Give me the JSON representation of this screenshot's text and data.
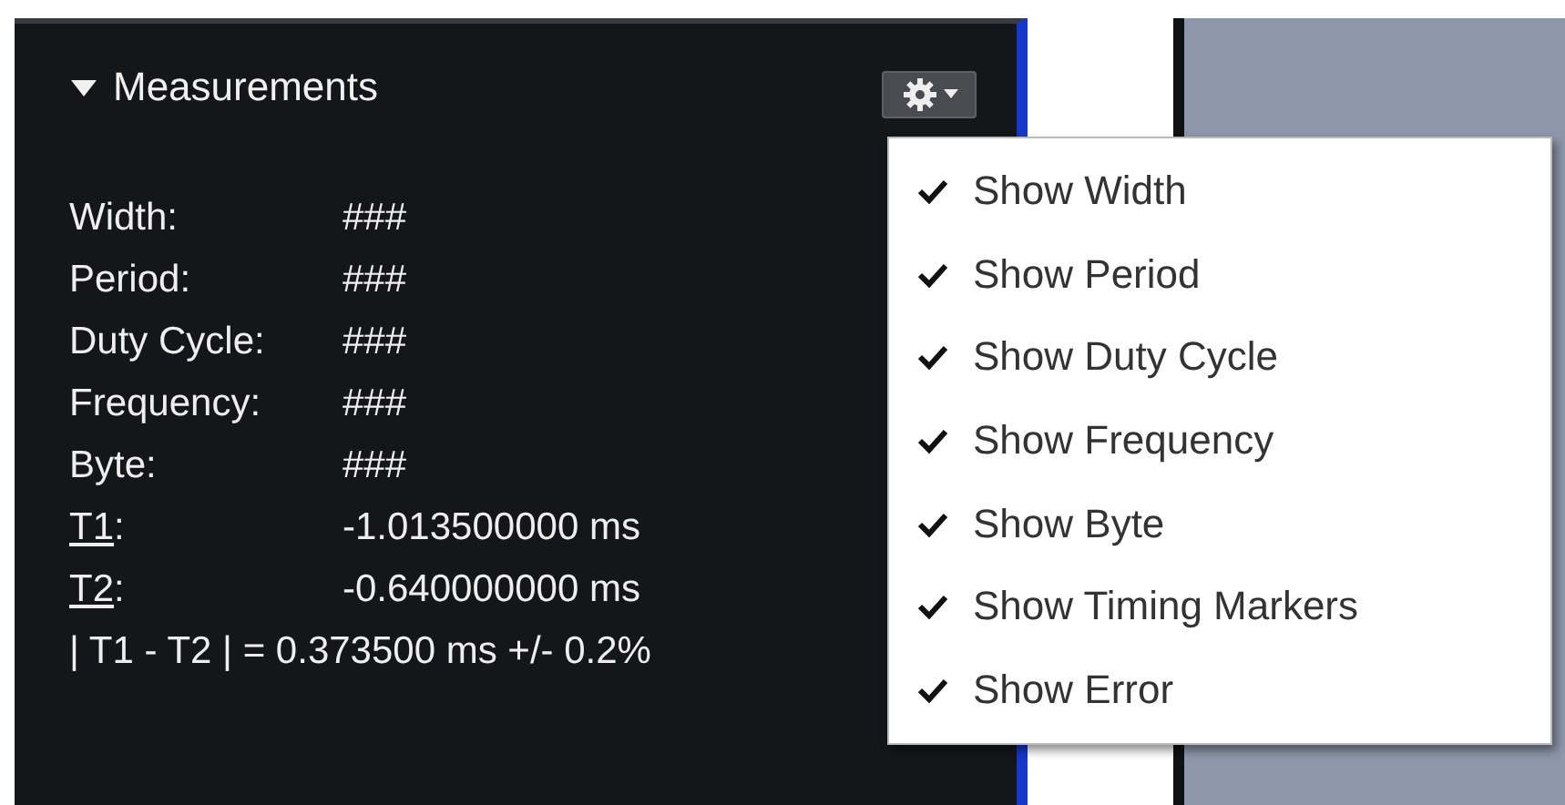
{
  "panel": {
    "title": "Measurements",
    "expanded": true,
    "rows": [
      {
        "kind": "plain",
        "label": "Width:",
        "value": "###"
      },
      {
        "kind": "plain",
        "label": "Period:",
        "value": "###"
      },
      {
        "kind": "plain",
        "label": "Duty Cycle:",
        "value": "###"
      },
      {
        "kind": "plain",
        "label": "Frequency:",
        "value": "###"
      },
      {
        "kind": "plain",
        "label": "Byte:",
        "value": "###"
      },
      {
        "kind": "marker",
        "label": "T1",
        "suffix": ":",
        "value": "-1.013500000 ms"
      },
      {
        "kind": "marker",
        "label": "T2",
        "suffix": ":",
        "value": "-0.640000000 ms"
      },
      {
        "kind": "summary",
        "label": "| T1 - T2 | = 0.373500 ms +/- 0.2%"
      }
    ]
  },
  "menu": {
    "items": [
      {
        "label": "Show Width",
        "checked": true
      },
      {
        "label": "Show Period",
        "checked": true
      },
      {
        "label": "Show Duty Cycle",
        "checked": true
      },
      {
        "label": "Show Frequency",
        "checked": true
      },
      {
        "label": "Show Byte",
        "checked": true
      },
      {
        "label": "Show Timing Markers",
        "checked": true
      },
      {
        "label": "Show Error",
        "checked": true
      }
    ]
  }
}
